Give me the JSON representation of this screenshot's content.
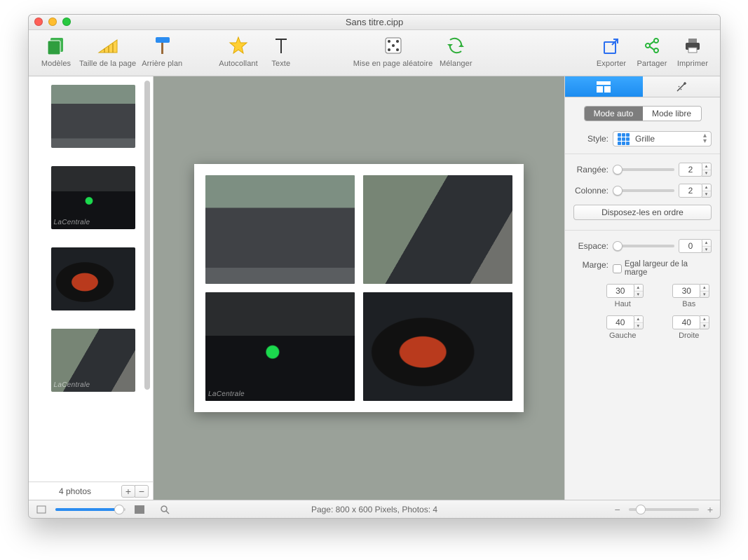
{
  "window": {
    "title": "Sans titre.cipp"
  },
  "toolbar": {
    "modeles": "Modèles",
    "taille": "Taille de la page",
    "arriere": "Arrière plan",
    "autocollant": "Autocollant",
    "texte": "Texte",
    "mise": "Mise en page aléatoire",
    "melanger": "Mélanger",
    "exporter": "Exporter",
    "partager": "Partager",
    "imprimer": "Imprimer"
  },
  "sidebar": {
    "count_label": "4 photos",
    "watermark": "LaCentrale"
  },
  "inspector": {
    "mode_auto": "Mode auto",
    "mode_libre": "Mode libre",
    "style_label": "Style:",
    "style_value": "Grille",
    "rangee_label": "Rangée:",
    "rangee_value": "2",
    "colonne_label": "Colonne:",
    "colonne_value": "2",
    "disposez": "Disposez-les en ordre",
    "espace_label": "Espace:",
    "espace_value": "0",
    "marge_label": "Marge:",
    "marge_equal": "Egal largeur de la marge",
    "haut_label": "Haut",
    "haut_value": "30",
    "bas_label": "Bas",
    "bas_value": "30",
    "gauche_label": "Gauche",
    "gauche_value": "40",
    "droite_label": "Droite",
    "droite_value": "40"
  },
  "status": {
    "page_info": "Page: 800 x 600 Pixels, Photos: 4"
  }
}
